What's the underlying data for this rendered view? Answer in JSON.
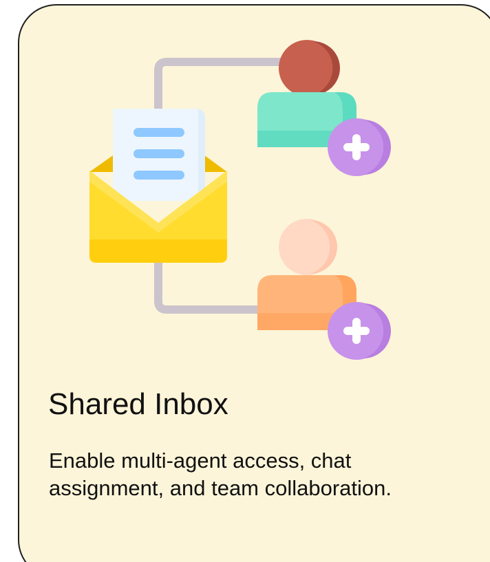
{
  "card": {
    "title": "Shared Inbox",
    "description": "Enable multi-agent access, chat assignment, and team collaboration."
  },
  "icons": {
    "mail": "envelope-with-letter-icon",
    "agent_top": "add-user-icon",
    "agent_bottom": "add-user-icon"
  },
  "colors": {
    "card_background": "#fdf5d9",
    "border": "#1f1f1f",
    "envelope": "#ffd51a",
    "connector": "#cbc4cc",
    "agent_top_body": "#7de6cb",
    "agent_bottom_body": "#ffb57a",
    "add_badge": "#c792ea"
  }
}
